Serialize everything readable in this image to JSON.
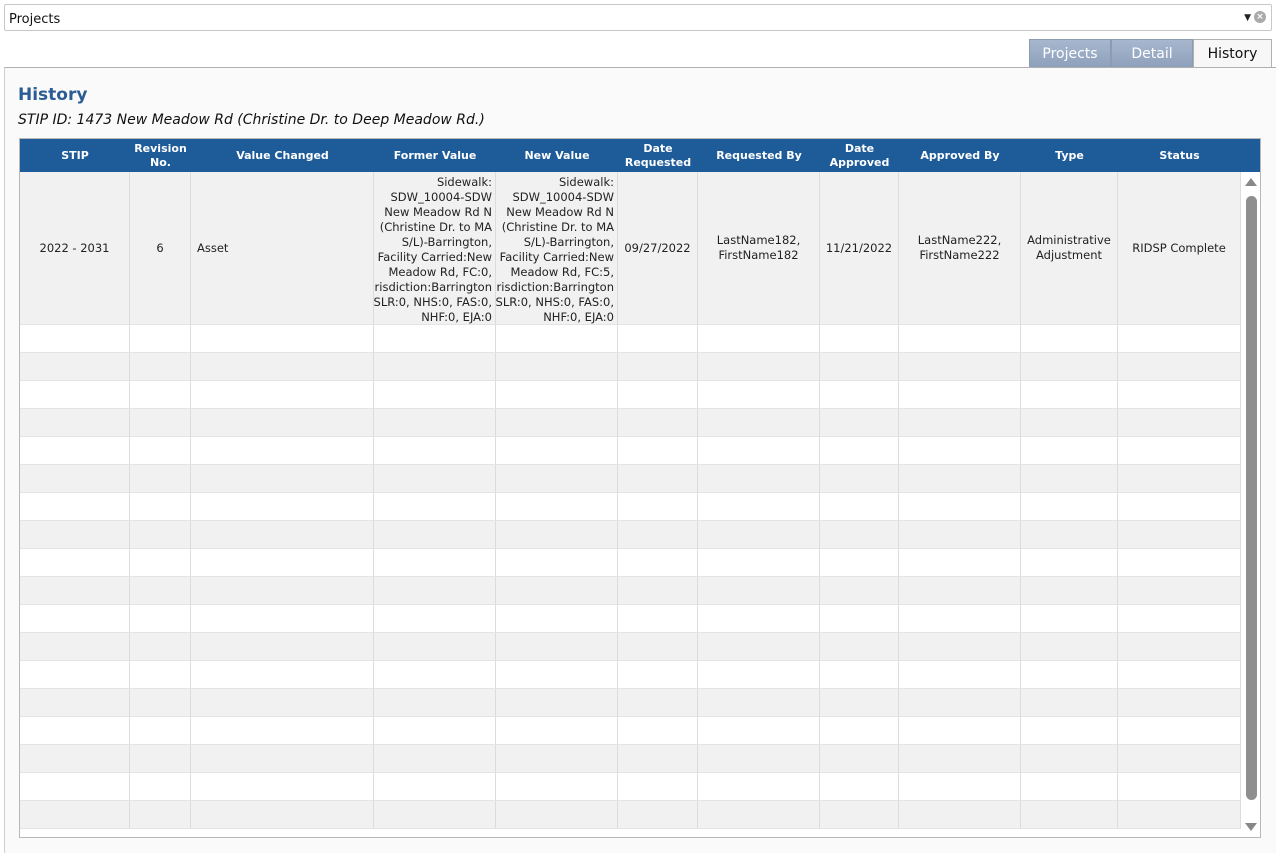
{
  "selector": {
    "value": "Projects"
  },
  "tabs": [
    {
      "label": "Projects",
      "active": false
    },
    {
      "label": "Detail",
      "active": false
    },
    {
      "label": "History",
      "active": true
    }
  ],
  "page": {
    "title": "History",
    "subtitle": "STIP ID: 1473 New Meadow Rd (Christine Dr. to Deep Meadow Rd.)"
  },
  "table": {
    "columns": [
      "STIP",
      "Revision\nNo.",
      "Value Changed",
      "Former Value",
      "New Value",
      "Date\nRequested",
      "Requested By",
      "Date\nApproved",
      "Approved By",
      "Type",
      "Status"
    ],
    "rows": [
      {
        "stip": "2022 - 2031",
        "revision": "6",
        "value_changed": "Asset",
        "former_value": "Sidewalk:\nSDW_10004-SDW\nNew Meadow Rd N\n(Christine Dr. to MA\nS/L)-Barrington,\nFacility Carried:New\nMeadow Rd, FC:0,\nJurisdiction:Barrington\nSLR:0, NHS:0, FAS:0,\nNHF:0, EJA:0",
        "new_value": "Sidewalk:\nSDW_10004-SDW\nNew Meadow Rd N\n(Christine Dr. to MA\nS/L)-Barrington,\nFacility Carried:New\nMeadow Rd, FC:5,\nJurisdiction:Barrington\nSLR:0, NHS:0, FAS:0,\nNHF:0, EJA:0",
        "date_requested": "09/27/2022",
        "requested_by": "LastName182,\nFirstName182",
        "date_approved": "11/21/2022",
        "approved_by": "LastName222,\nFirstName222",
        "type": "Administrative\nAdjustment",
        "status": "RIDSP Complete"
      }
    ],
    "empty_rows": 18
  },
  "colors": {
    "header": "#1d5b99",
    "title": "#2b5c93",
    "tab_inactive": "#98a9c4"
  }
}
